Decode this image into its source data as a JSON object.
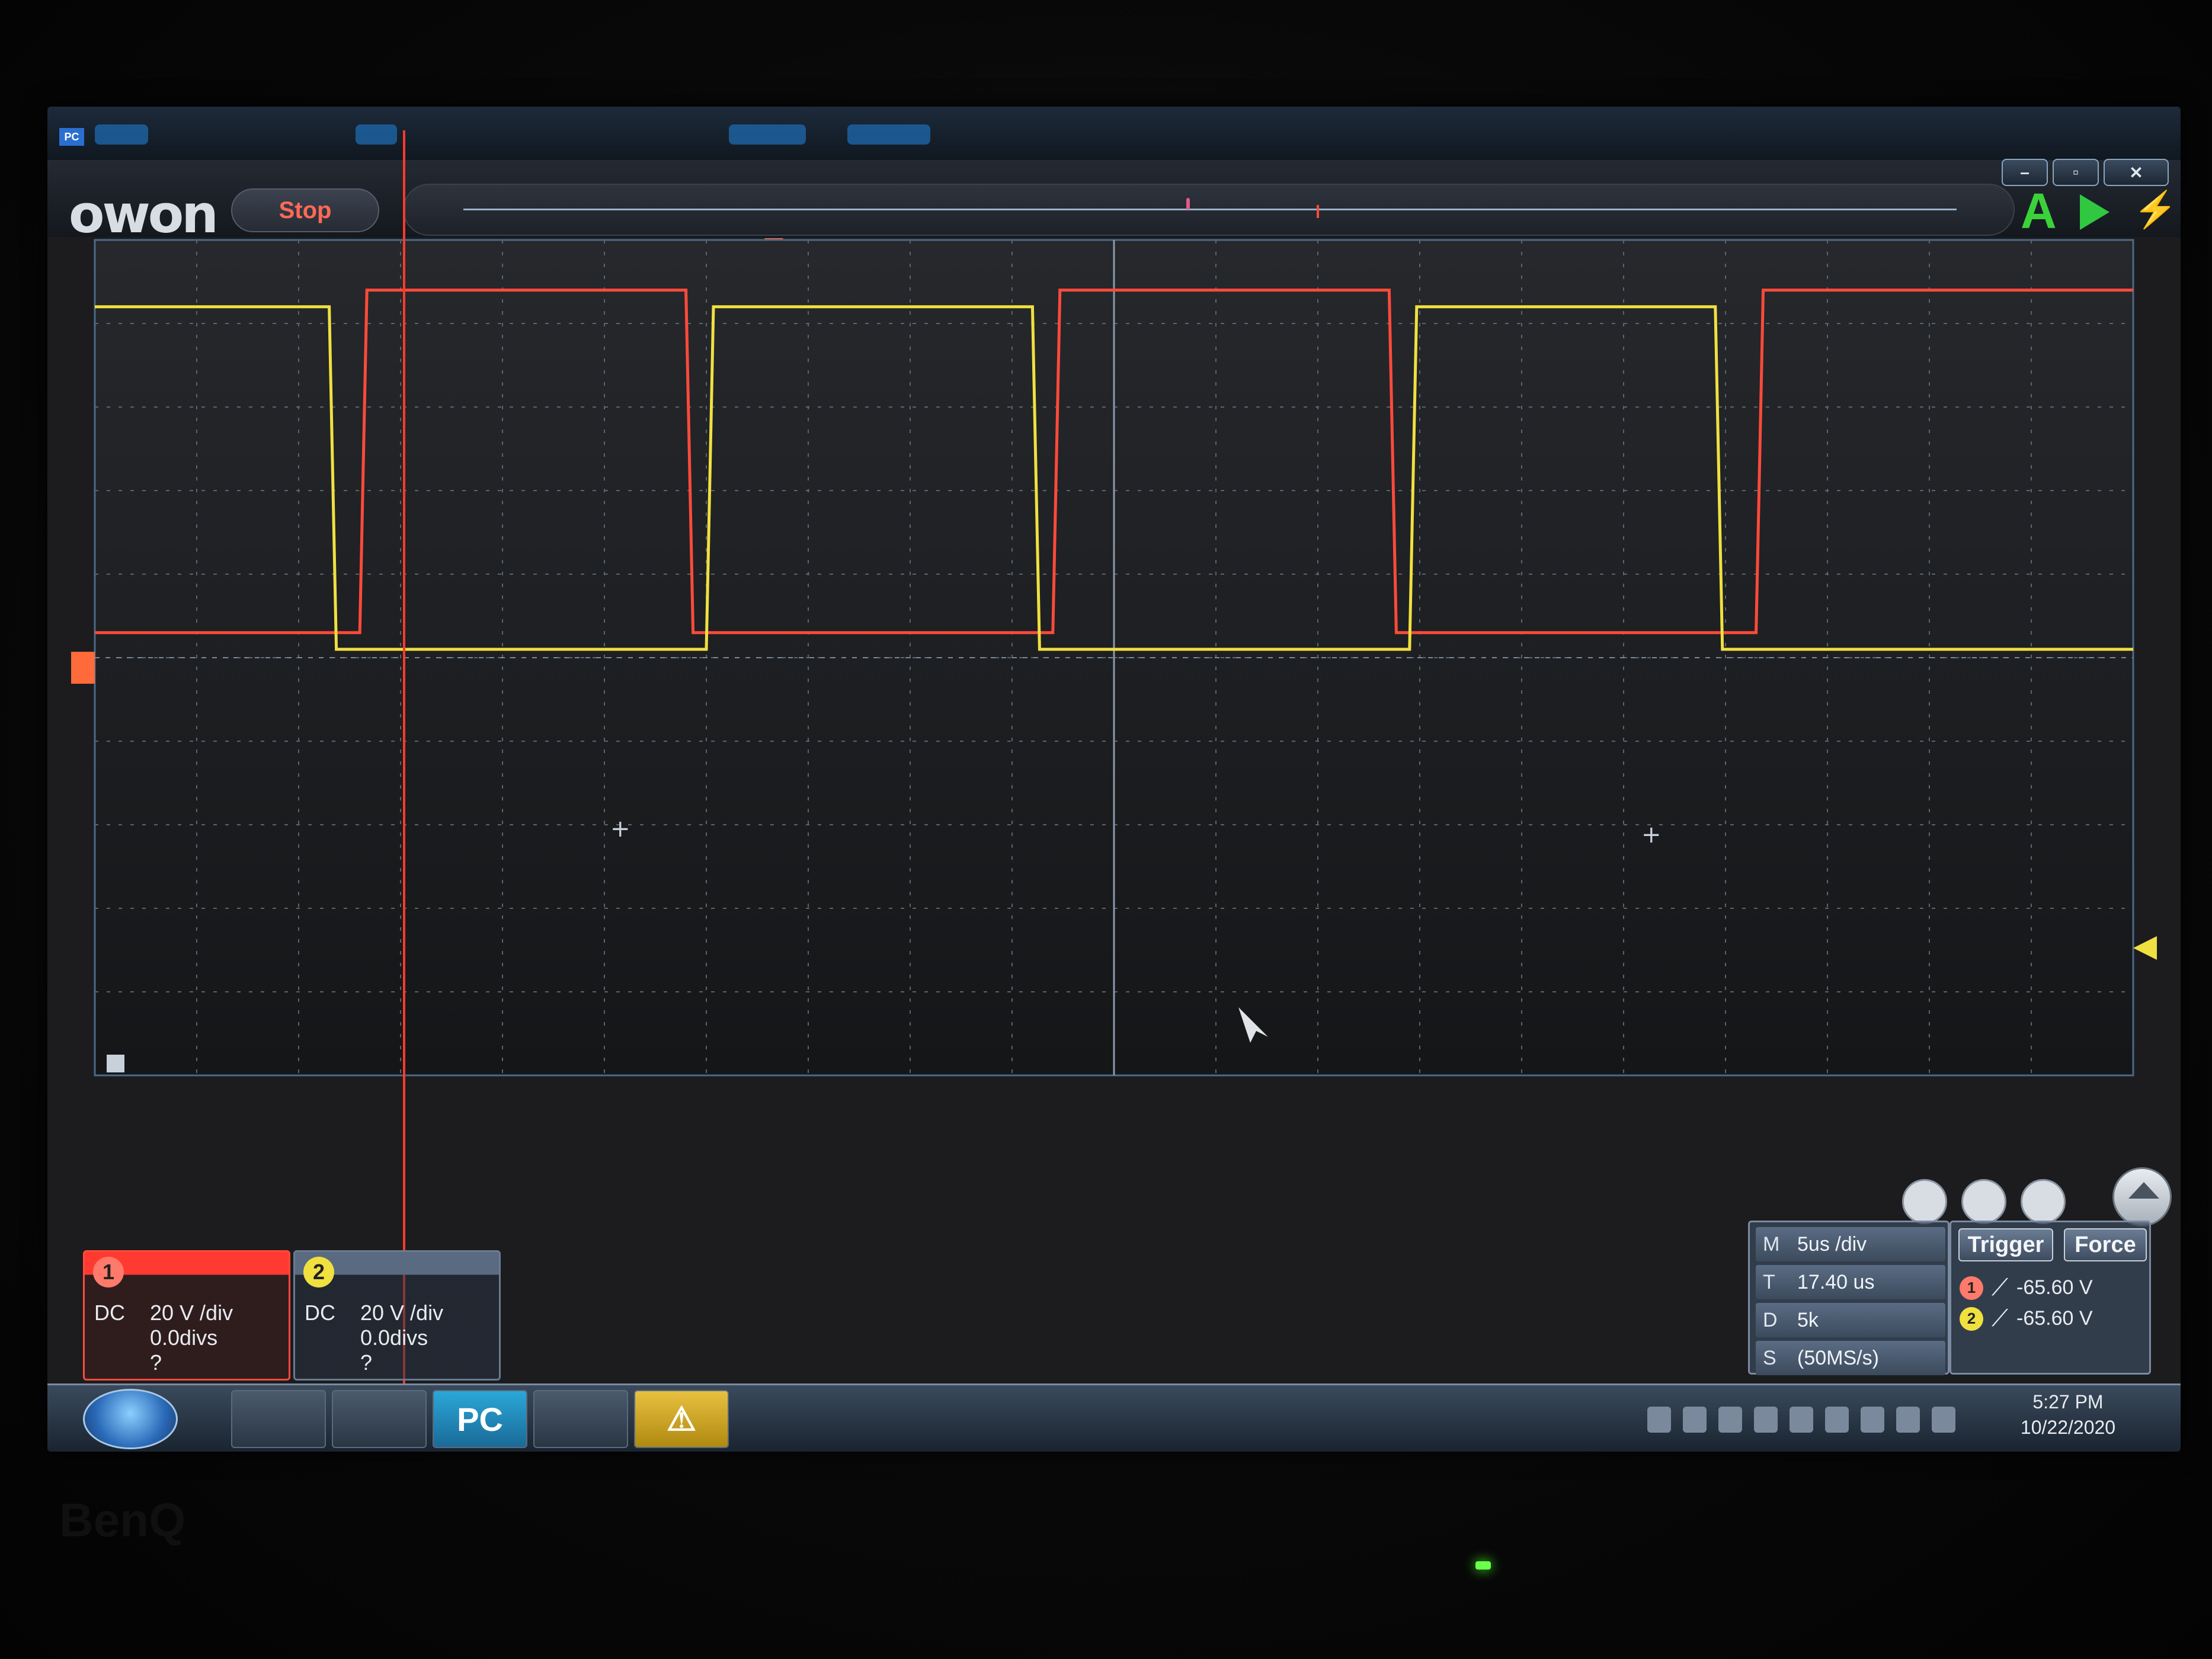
{
  "app": {
    "logo_text": "owon",
    "title_badge": "PC",
    "status_button": "Stop",
    "auto_label": "A"
  },
  "window_controls": {
    "minimize": "–",
    "restore": "▫",
    "close": "✕"
  },
  "channels": [
    {
      "number": "1",
      "coupling": "DC",
      "scale": "20 V /div",
      "offset": "0.0divs",
      "measure": "?",
      "color": "#ff4a3a"
    },
    {
      "number": "2",
      "coupling": "DC",
      "scale": "20 V /div",
      "offset": "0.0divs",
      "measure": "?",
      "color": "#f0e040"
    }
  ],
  "timebase": {
    "rows": [
      {
        "key": "M",
        "value": "5us /div"
      },
      {
        "key": "T",
        "value": "17.40 us"
      },
      {
        "key": "D",
        "value": "5k"
      },
      {
        "key": "S",
        "value": "(50MS/s)"
      }
    ]
  },
  "trigger": {
    "trigger_label": "Trigger",
    "force_label": "Force",
    "sources": [
      {
        "channel": "1",
        "edge": "rising",
        "level": "-65.60 V",
        "color": "#ff7a6a"
      },
      {
        "channel": "2",
        "edge": "rising",
        "level": "-65.60 V",
        "color": "#f0e040"
      }
    ]
  },
  "control_icons": [
    "recall-icon",
    "save-icon",
    "export-icon",
    "home-icon"
  ],
  "taskbar": {
    "apps": [
      "file-explorer-icon",
      "media-player-icon",
      "owon-pc-icon",
      "chrome-icon",
      "warning-icon"
    ],
    "owon_glyph": "PC",
    "warning_glyph": "⚠",
    "clock_time": "5:27 PM",
    "clock_date": "10/22/2020"
  },
  "waveform": {
    "grid": {
      "horizontal_divisions": 20,
      "vertical_divisions": 10,
      "grid_on": true
    },
    "ch1_trace": {
      "color": "#ff4a3a",
      "shape": "square",
      "high_div": 4.2,
      "low_div": 0.1
    },
    "ch2_trace": {
      "color": "#f0e040",
      "shape": "square",
      "high_div": 4.0,
      "low_div": -0.1
    },
    "cursor": {
      "color": "#ff3a2a"
    }
  },
  "monitor": {
    "brand": "BenQ"
  }
}
